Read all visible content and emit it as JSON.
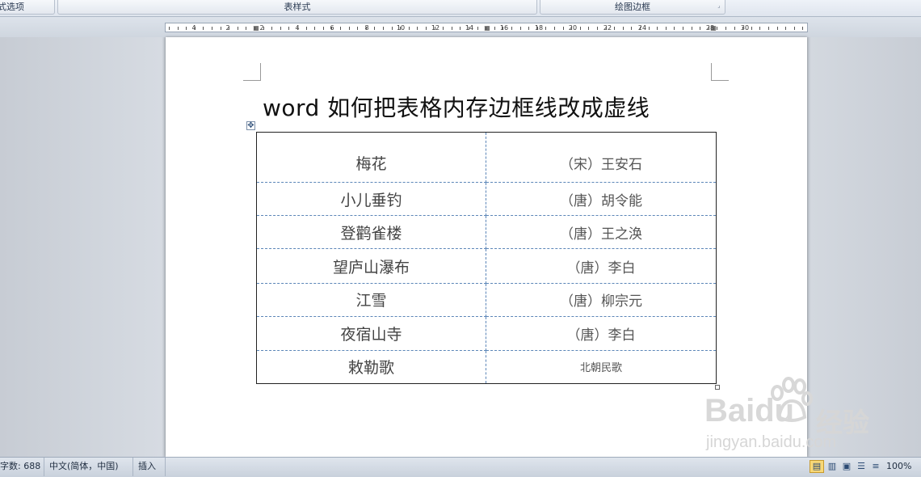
{
  "ribbon": {
    "group1_label": "式选项",
    "group2_label": "表样式",
    "group3_label": "绘图边框"
  },
  "ruler": {
    "labels": [
      "4",
      "2",
      "2",
      "4",
      "6",
      "8",
      "10",
      "12",
      "14",
      "16",
      "18",
      "20",
      "22",
      "24",
      "28",
      "30"
    ]
  },
  "document": {
    "title": "word 如何把表格内存边框线改成虚线",
    "table": [
      {
        "poem": "梅花",
        "author": "（宋）王安石"
      },
      {
        "poem": "小儿垂钓",
        "author": "（唐）胡令能"
      },
      {
        "poem": "登鹳雀楼",
        "author": "（唐）王之涣"
      },
      {
        "poem": "望庐山瀑布",
        "author": "（唐）李白"
      },
      {
        "poem": "江雪",
        "author": "（唐）柳宗元"
      },
      {
        "poem": "夜宿山寺",
        "author": "（唐）李白"
      },
      {
        "poem": "敕勒歌",
        "author": "北朝民歌"
      }
    ]
  },
  "watermark": {
    "brand": "Baidu",
    "experience": "经验",
    "url": "jingyan.baidu.com"
  },
  "status": {
    "word_count": "字数: 688",
    "language": "中文(简体，中国)",
    "mode": "插入",
    "zoom": "100%"
  },
  "icons": {
    "print_layout": "print-layout-icon",
    "full_screen_reading": "full-screen-reading-icon",
    "web_layout": "web-layout-icon",
    "outline": "outline-icon",
    "draft": "draft-icon"
  }
}
